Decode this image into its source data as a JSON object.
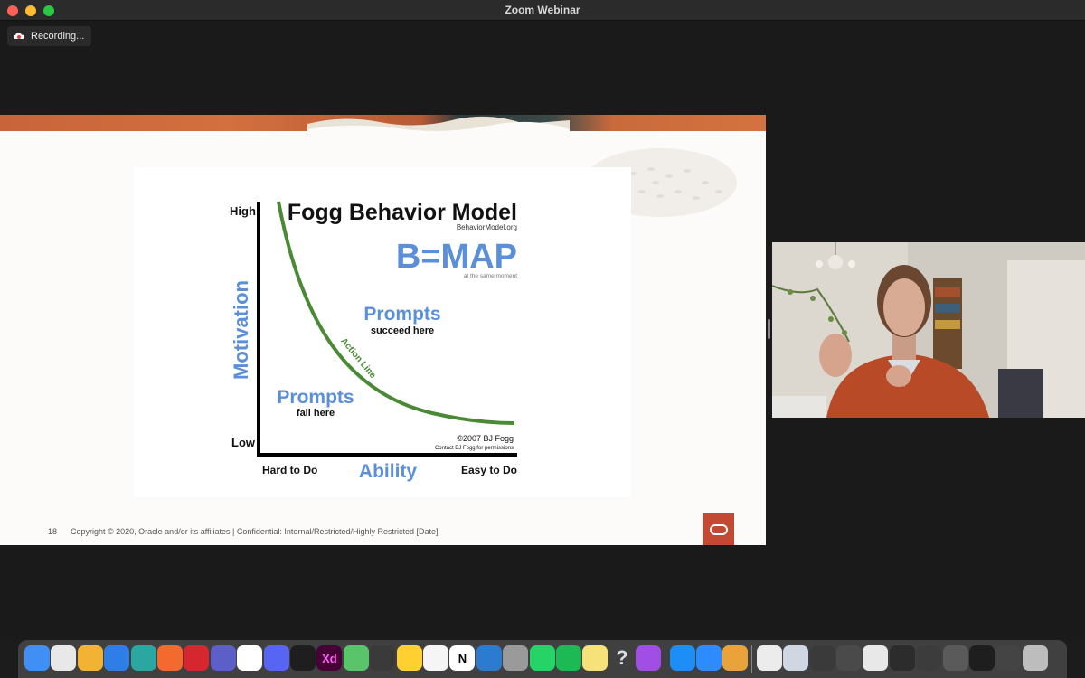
{
  "window": {
    "title": "Zoom Webinar"
  },
  "recording": {
    "label": "Recording..."
  },
  "slide": {
    "diagram": {
      "title": "Fogg Behavior Model",
      "site": "BehaviorModel.org",
      "formula": "B=MAP",
      "formula_note": "at the same moment",
      "prompts_top": "Prompts",
      "prompts_top_sub": "succeed here",
      "prompts_bottom": "Prompts",
      "prompts_bottom_sub": "fail here",
      "action_line": "Action Line",
      "y_axis": "Motivation",
      "y_high": "High",
      "y_low": "Low",
      "x_axis": "Ability",
      "x_left": "Hard to Do",
      "x_right": "Easy to Do",
      "credit": "©2007 BJ Fogg",
      "credit_sub": "Contact BJ Fogg for permissions"
    },
    "footer": {
      "page_number": "18",
      "copyright": "Copyright © 2020, Oracle and/or its affiliates  |  Confidential: Internal/Restricted/Highly Restricted   [Date]"
    }
  },
  "colors": {
    "accent_blue": "#5b8fd9",
    "curve_green": "#4a8a35",
    "oracle_red": "#c24a33"
  },
  "dock": {
    "items": [
      {
        "name": "finder-icon",
        "label": "",
        "color": "#3f8ff5"
      },
      {
        "name": "chrome-icon",
        "label": "",
        "color": "#e8e8e8"
      },
      {
        "name": "chrome-canary-icon",
        "label": "",
        "color": "#f2b233"
      },
      {
        "name": "safari-icon",
        "label": "",
        "color": "#2f7de6"
      },
      {
        "name": "edge-beta-icon",
        "label": "",
        "color": "#2aa7a0"
      },
      {
        "name": "firefox-icon",
        "label": "",
        "color": "#f26a2e"
      },
      {
        "name": "opera-icon",
        "label": "",
        "color": "#d6262f"
      },
      {
        "name": "teams-icon",
        "label": "",
        "color": "#5b5fc7"
      },
      {
        "name": "slack-icon",
        "label": "",
        "color": "#ffffff"
      },
      {
        "name": "discord-icon",
        "label": "",
        "color": "#5865f2"
      },
      {
        "name": "figma-icon",
        "label": "",
        "color": "#1e1e1e"
      },
      {
        "name": "xd-icon",
        "label": "Xd",
        "color": "#470137"
      },
      {
        "name": "git-icon",
        "label": "",
        "color": "#5ac46b"
      },
      {
        "name": "bird-icon",
        "label": "",
        "color": "#3a3a3a"
      },
      {
        "name": "miro-icon",
        "label": "",
        "color": "#ffd02f"
      },
      {
        "name": "mail-icon",
        "label": "",
        "color": "#f5f5f5"
      },
      {
        "name": "notion-icon",
        "label": "N",
        "color": "#ffffff"
      },
      {
        "name": "trello-icon",
        "label": "",
        "color": "#2b7bd0"
      },
      {
        "name": "settings-icon",
        "label": "",
        "color": "#9a9a9a"
      },
      {
        "name": "whatsapp-icon",
        "label": "",
        "color": "#25d366"
      },
      {
        "name": "spotify-icon",
        "label": "",
        "color": "#1db954"
      },
      {
        "name": "notes-icon",
        "label": "",
        "color": "#f7e27a"
      },
      {
        "name": "help-icon",
        "label": "?",
        "color": "#555555"
      },
      {
        "name": "podcasts-icon",
        "label": "",
        "color": "#a04ee3"
      },
      {
        "name": "app-store-icon",
        "label": "",
        "color": "#1d8ef5"
      },
      {
        "name": "zoom-icon",
        "label": "",
        "color": "#2d8cff"
      },
      {
        "name": "location-icon",
        "label": "",
        "color": "#e9a33a"
      },
      {
        "name": "document-icon",
        "label": "",
        "color": "#ececec"
      },
      {
        "name": "window-thumbnail-icon",
        "label": "",
        "color": "#cfd8e2"
      },
      {
        "name": "window-thumbnail-icon",
        "label": "",
        "color": "#3a3a3a"
      },
      {
        "name": "window-thumbnail-icon",
        "label": "",
        "color": "#4a4a4a"
      },
      {
        "name": "window-thumbnail-icon",
        "label": "",
        "color": "#e8e8e8"
      },
      {
        "name": "window-thumbnail-icon",
        "label": "",
        "color": "#2c2c2c"
      },
      {
        "name": "window-thumbnail-icon",
        "label": "",
        "color": "#3c3c3c"
      },
      {
        "name": "window-thumbnail-icon",
        "label": "",
        "color": "#5a5a5a"
      },
      {
        "name": "window-thumbnail-icon",
        "label": "",
        "color": "#1e1e1e"
      },
      {
        "name": "window-thumbnail-icon",
        "label": "",
        "color": "#444444"
      },
      {
        "name": "trash-icon",
        "label": "",
        "color": "#bdbdbd"
      }
    ]
  }
}
